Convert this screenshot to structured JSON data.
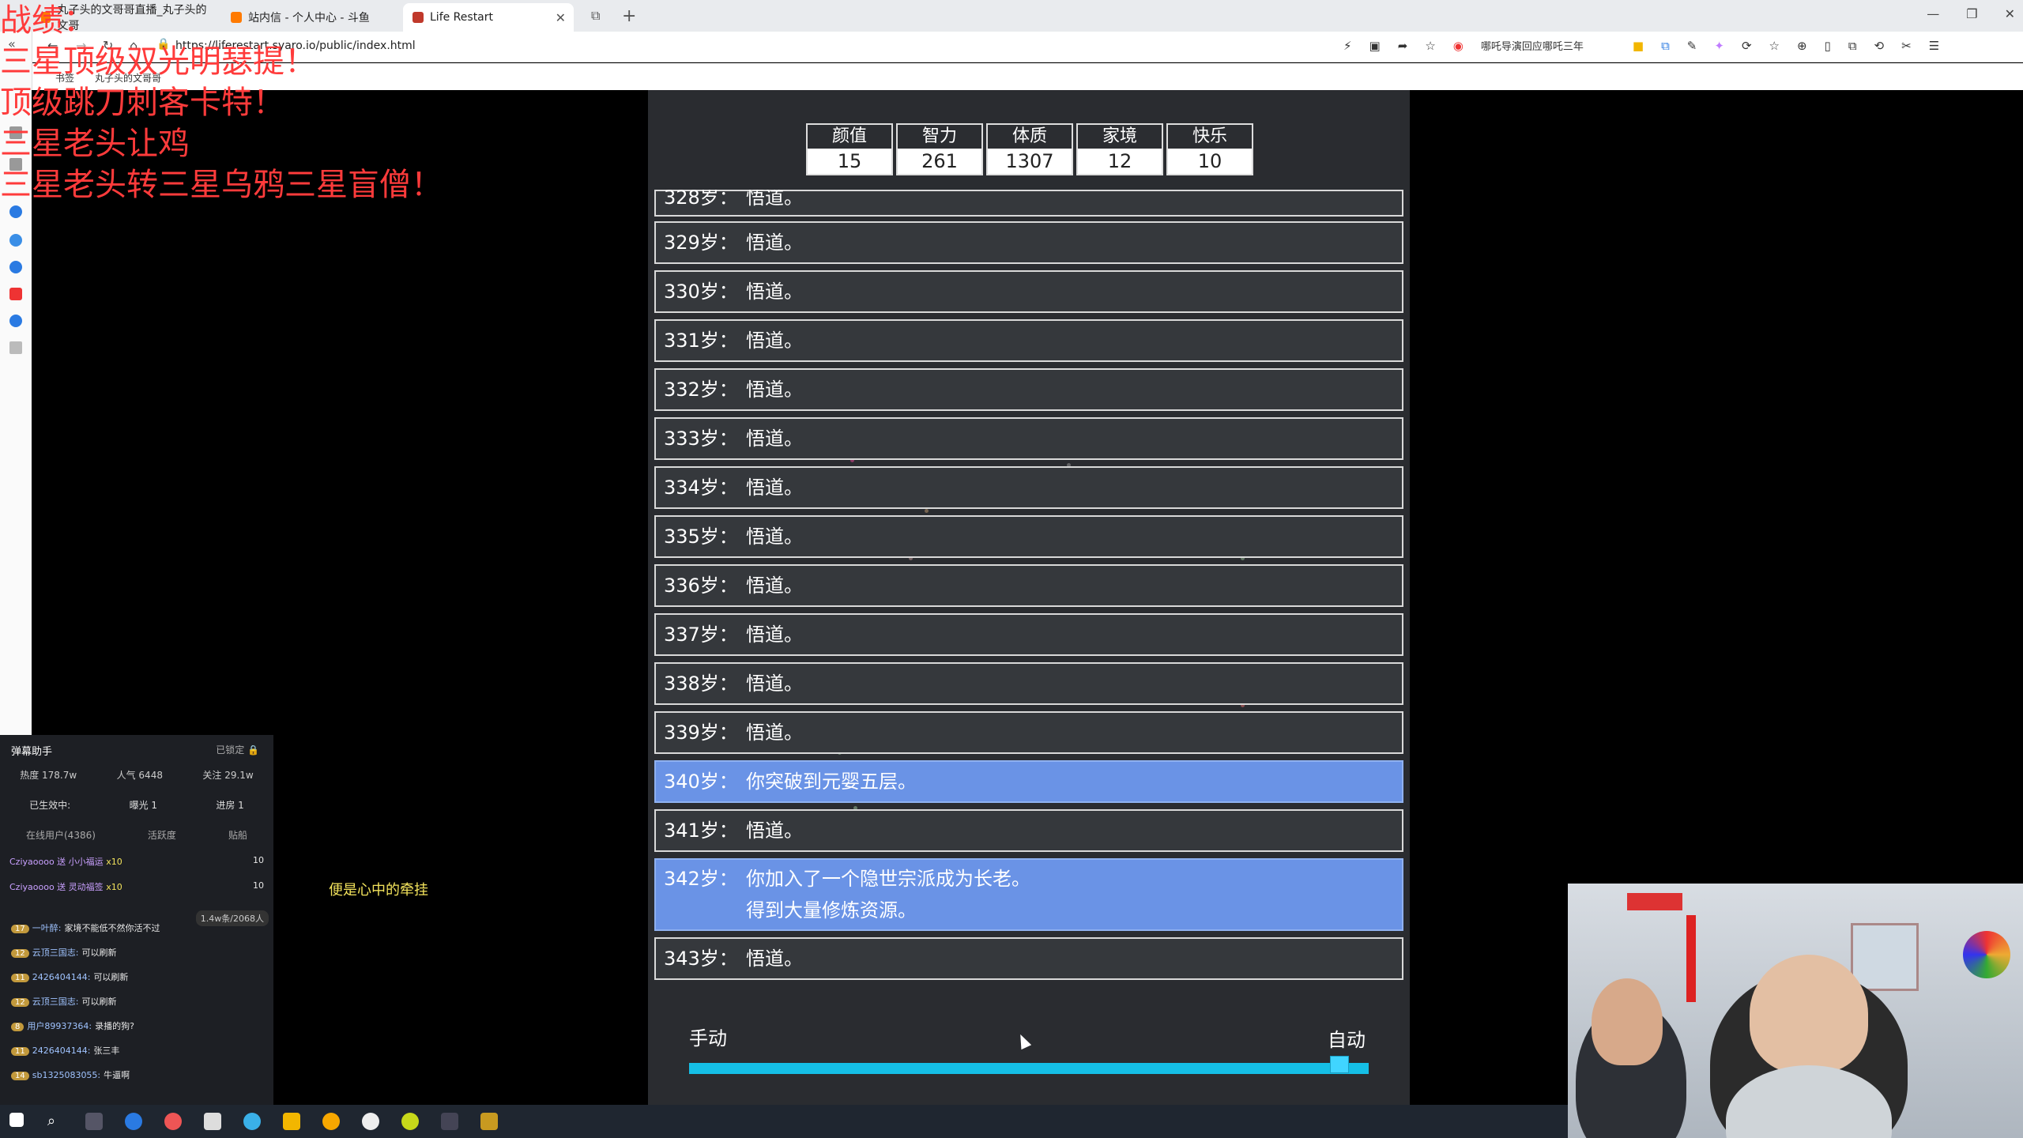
{
  "browser": {
    "tabs": [
      {
        "label": "丸子头的文哥哥直播_丸子头的文哥"
      },
      {
        "label": "站内信 - 个人中心 - 斗鱼"
      },
      {
        "label": "Life Restart"
      }
    ],
    "url": "https://liferestart.syaro.io/public/index.html",
    "suggest": "哪吒导演回应哪吒三年",
    "bookmarks": [
      "书签",
      "丸子头的文哥哥"
    ]
  },
  "overlay": {
    "lines": [
      "战绩：",
      "三星顶级双光明瑟提！",
      "顶级跳刀刺客卡特！",
      "三星老头让鸡",
      "三星老头转三星乌鸦三星盲僧！"
    ]
  },
  "properties": [
    {
      "label": "颜值",
      "value": "15"
    },
    {
      "label": "智力",
      "value": "261"
    },
    {
      "label": "体质",
      "value": "1307"
    },
    {
      "label": "家境",
      "value": "12"
    },
    {
      "label": "快乐",
      "value": "10"
    }
  ],
  "timeline": [
    {
      "age": "328岁：",
      "text": "悟道。",
      "hl": false
    },
    {
      "age": "329岁：",
      "text": "悟道。",
      "hl": false
    },
    {
      "age": "330岁：",
      "text": "悟道。",
      "hl": false
    },
    {
      "age": "331岁：",
      "text": "悟道。",
      "hl": false
    },
    {
      "age": "332岁：",
      "text": "悟道。",
      "hl": false
    },
    {
      "age": "333岁：",
      "text": "悟道。",
      "hl": false
    },
    {
      "age": "334岁：",
      "text": "悟道。",
      "hl": false
    },
    {
      "age": "335岁：",
      "text": "悟道。",
      "hl": false
    },
    {
      "age": "336岁：",
      "text": "悟道。",
      "hl": false
    },
    {
      "age": "337岁：",
      "text": "悟道。",
      "hl": false
    },
    {
      "age": "338岁：",
      "text": "悟道。",
      "hl": false
    },
    {
      "age": "339岁：",
      "text": "悟道。",
      "hl": false
    },
    {
      "age": "340岁：",
      "text": "你突破到元婴五层。",
      "hl": true
    },
    {
      "age": "341岁：",
      "text": "悟道。",
      "hl": false
    },
    {
      "age": "342岁：",
      "text": "你加入了一个隐世宗派成为长老。\n得到大量修炼资源。",
      "hl": true
    },
    {
      "age": "343岁：",
      "text": "悟道。",
      "hl": false
    }
  ],
  "mode": {
    "manual": "手动",
    "auto": "自动",
    "level": 0.97
  },
  "lyric": "便是心中的牵挂",
  "danmaku": {
    "title": "弹幕助手",
    "lock": "已锁定",
    "stats": [
      "热度 178.7w",
      "人气 6448",
      "关注 29.1w"
    ],
    "row1": [
      "已生效中:",
      "曝光 1",
      "进房 1"
    ],
    "row2": [
      "在线用户(4386)",
      "活跃度",
      "贴船"
    ],
    "gifts": [
      {
        "text": "Cziyaoooo 送 小小福运",
        "count": "x10",
        "num": "10"
      },
      {
        "text": "Cziyaoooo 送 灵动福签",
        "count": "x10",
        "num": "10"
      }
    ],
    "viewers": "1.4w条/2068人",
    "messages": [
      {
        "badge": "17",
        "user": "一叶醉:",
        "text": "家境不能低不然你活不过"
      },
      {
        "badge": "12",
        "user": "云顶三国志:",
        "text": "可以刷新"
      },
      {
        "badge": "11",
        "user": "2426404144:",
        "text": "可以刷新"
      },
      {
        "badge": "12",
        "user": "云顶三国志:",
        "text": "可以刷新"
      },
      {
        "badge": "8",
        "user": "用户89937364:",
        "text": "录播的狗?"
      },
      {
        "badge": "11",
        "user": "2426404144:",
        "text": "张三丰"
      },
      {
        "badge": "14",
        "user": "sb1325083055:",
        "text": "牛逼啊"
      }
    ]
  }
}
